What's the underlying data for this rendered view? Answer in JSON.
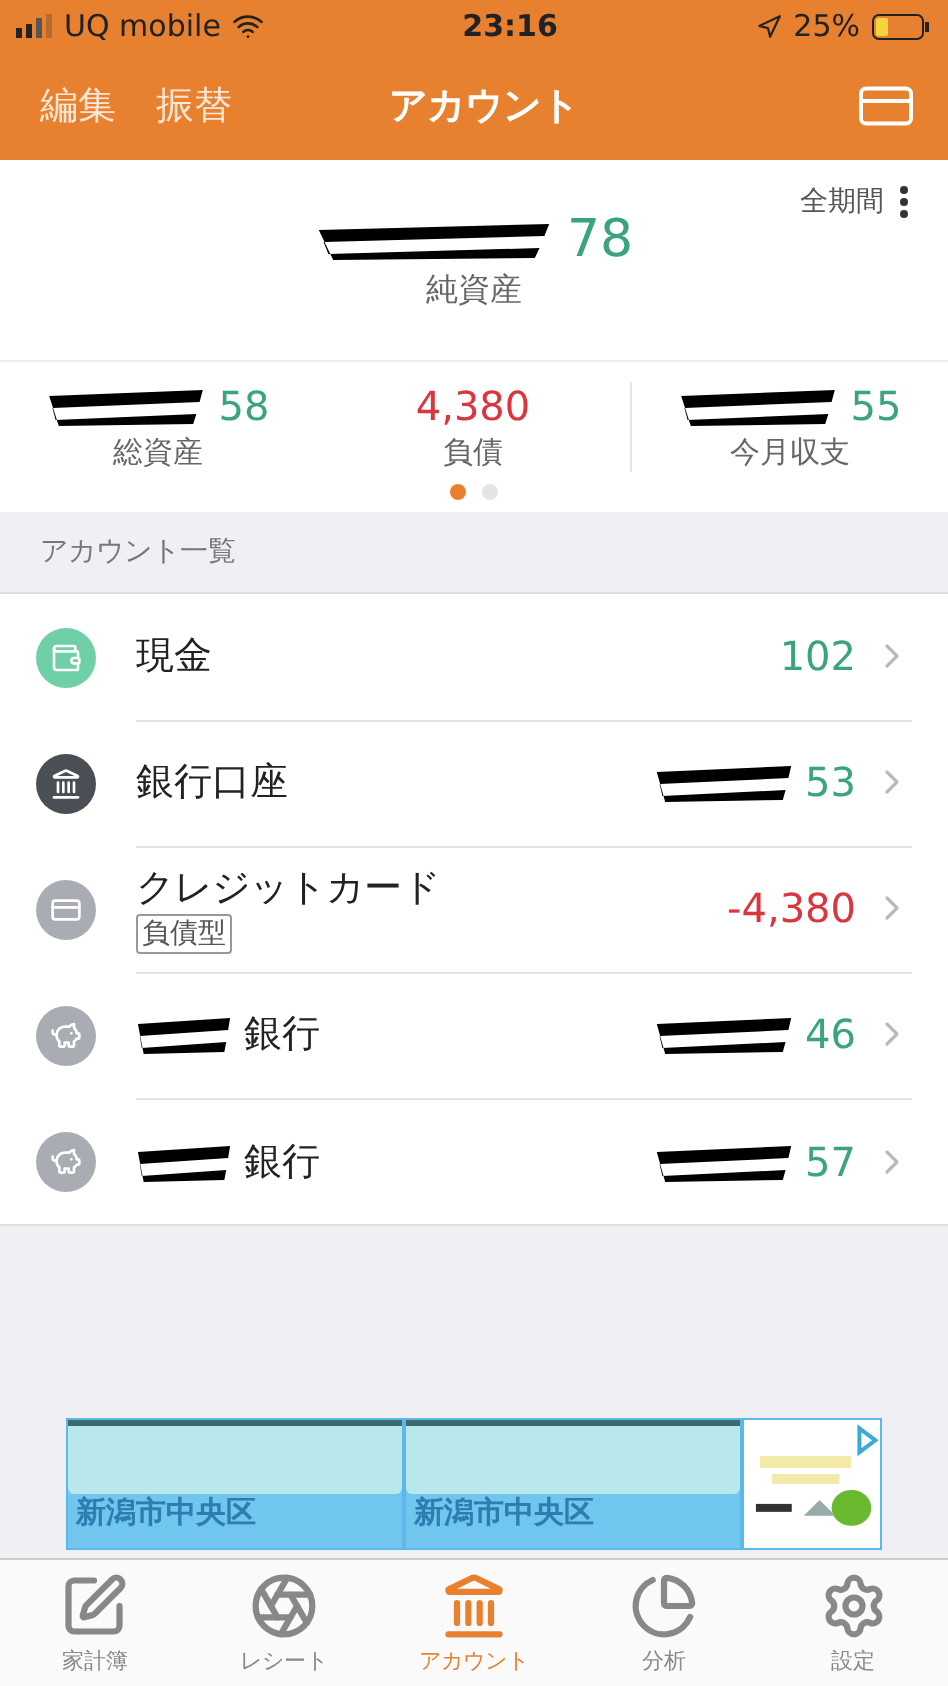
{
  "status_bar": {
    "carrier": "UQ mobile",
    "time": "23:16",
    "battery": "25%"
  },
  "nav": {
    "left": [
      "編集",
      "振替"
    ],
    "title": "アカウント"
  },
  "summary": {
    "period": "全期間",
    "net": {
      "value": "78",
      "color": "#3aa57a",
      "label": "純資産",
      "redacted": true
    },
    "stats": [
      {
        "value": "58",
        "color": "#3aa57a",
        "label": "総資産",
        "redacted": true
      },
      {
        "value": "4,380",
        "color": "#d9363e",
        "label": "負債",
        "redacted": false
      },
      {
        "value": "55",
        "color": "#3aa57a",
        "label": "今月収支",
        "redacted": true
      }
    ],
    "pages": [
      {
        "selected": true
      },
      {
        "selected": false
      }
    ]
  },
  "section": "アカウント一覧",
  "accounts": [
    {
      "kind": "wallet",
      "color": "#6fcfa6",
      "name": "現金",
      "name_redacted": false,
      "balance": {
        "text": "102",
        "color": "#3aa57a"
      },
      "redacted": false
    },
    {
      "kind": "bank",
      "color": "#4a4e55",
      "name": "銀行口座",
      "name_redacted": false,
      "balance": {
        "text": "53",
        "color": "#3aa57a"
      },
      "redacted": true
    },
    {
      "kind": "card",
      "color": "#a9adb3",
      "name": "クレジットカード",
      "tag": "負債型",
      "name_redacted": false,
      "balance": {
        "text": "-4,380",
        "color": "#d9363e"
      },
      "redacted": false
    },
    {
      "kind": "piggy",
      "color": "#a9adb3",
      "name": "銀行",
      "name_redacted": true,
      "balance": {
        "text": "46",
        "color": "#3aa57a"
      },
      "redacted": true
    },
    {
      "kind": "piggy",
      "color": "#a9adb3",
      "name": "銀行",
      "name_redacted": true,
      "balance": {
        "text": "57",
        "color": "#3aa57a"
      },
      "redacted": true
    }
  ],
  "ad": {
    "tiles": [
      "新潟市中央区",
      "新潟市中央区"
    ],
    "image": {
      "kind": "picture"
    }
  },
  "tabs": [
    {
      "kind": "book",
      "label": "家計簿",
      "selected": false
    },
    {
      "kind": "receipt",
      "label": "レシート",
      "selected": false
    },
    {
      "kind": "account",
      "label": "アカウント",
      "selected": true
    },
    {
      "kind": "analysis",
      "label": "分析",
      "selected": false
    },
    {
      "kind": "settings",
      "label": "設定",
      "selected": false
    }
  ]
}
